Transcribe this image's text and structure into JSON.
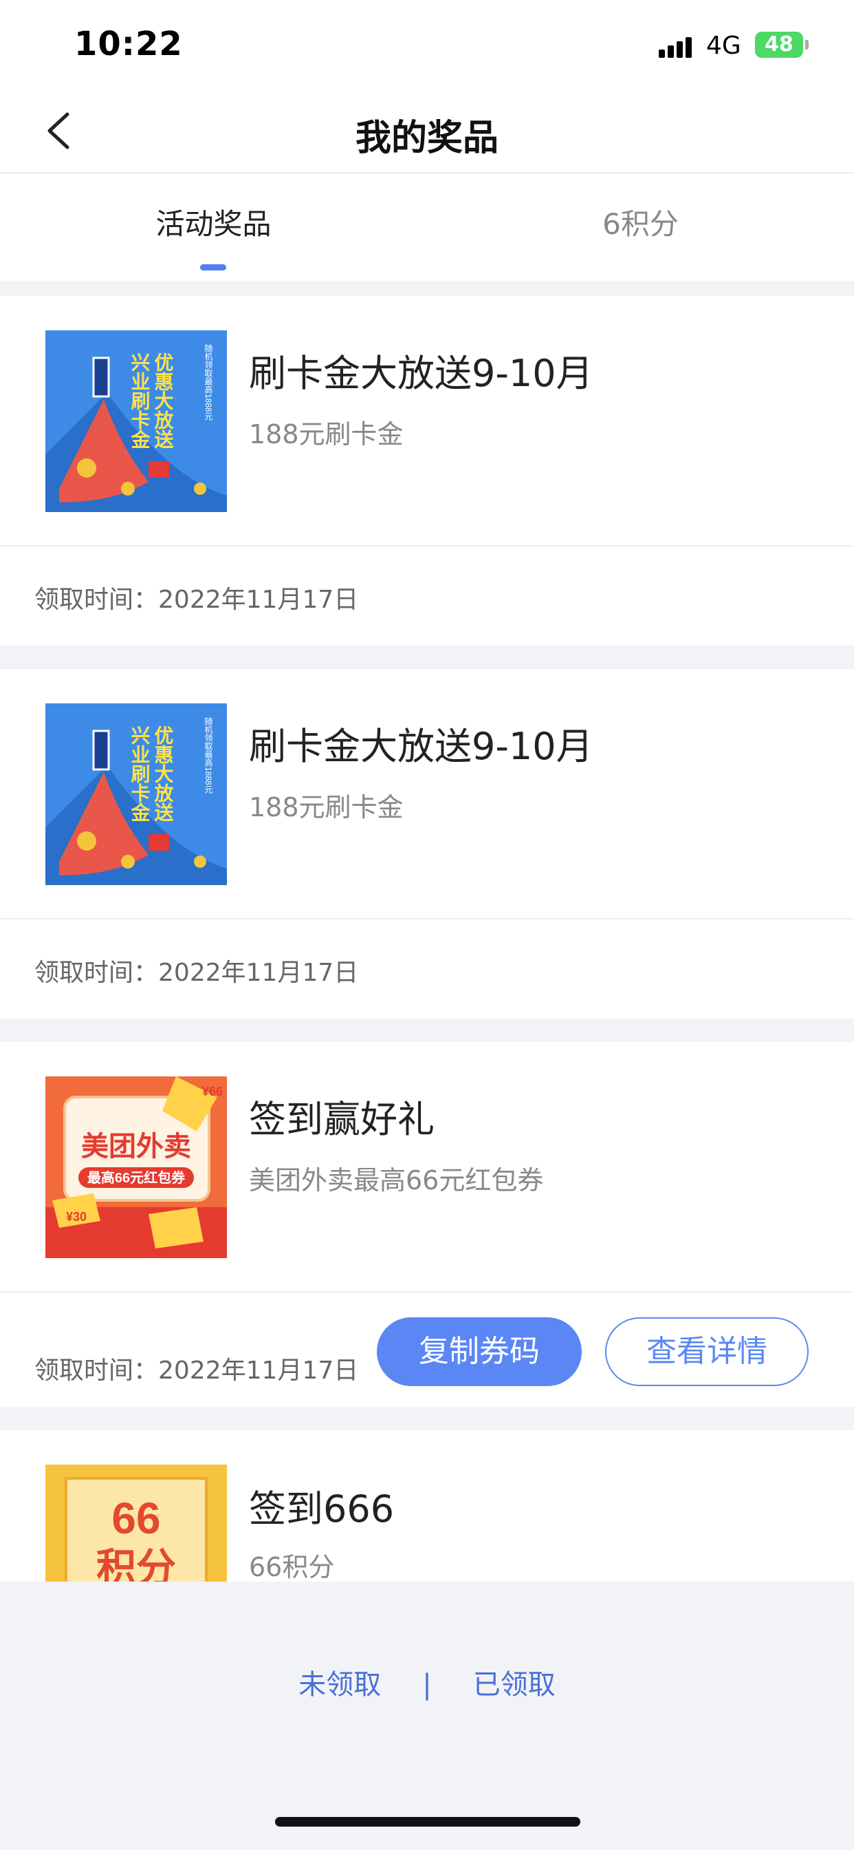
{
  "status_bar": {
    "time": "10:22",
    "network": "4G",
    "battery": "48"
  },
  "nav": {
    "title": "我的奖品",
    "back_icon": "chevron-left-icon"
  },
  "tabs": [
    {
      "label": "活动奖品",
      "active": true
    },
    {
      "label": "6积分",
      "active": false
    }
  ],
  "prizes": [
    {
      "title": "刷卡金大放送9-10月",
      "subtitle": "188元刷卡金",
      "time_label": "领取时间：",
      "time_value": "2022年11月17日",
      "thumb": {
        "big_text": "优惠大放送",
        "brand_text": "兴业刷卡金",
        "side_text": "随机领取最高1888元"
      }
    },
    {
      "title": "刷卡金大放送9-10月",
      "subtitle": "188元刷卡金",
      "time_label": "领取时间：",
      "time_value": "2022年11月17日",
      "thumb": {
        "big_text": "优惠大放送",
        "brand_text": "兴业刷卡金",
        "side_text": "随机领取最高1888元"
      }
    },
    {
      "title": "签到赢好礼",
      "subtitle": "美团外卖最高66元红包券",
      "time_label": "领取时间：",
      "time_value": "2022年11月17日",
      "copy_label": "复制券码",
      "detail_label": "查看详情",
      "thumb": {
        "brand_text": "美团外卖",
        "tag_text": "最高66元红包券",
        "coupon_a": "¥66",
        "coupon_b": "¥30"
      }
    },
    {
      "title": "签到666",
      "subtitle": "66积分",
      "thumb": {
        "line1": "66",
        "line2": "积分"
      }
    }
  ],
  "footer": {
    "unclaimed": "未领取",
    "separator": "|",
    "claimed": "已领取"
  },
  "colors": {
    "accent": "#5b87f5",
    "link": "#4a6fd8",
    "background": "#f2f3f7"
  }
}
